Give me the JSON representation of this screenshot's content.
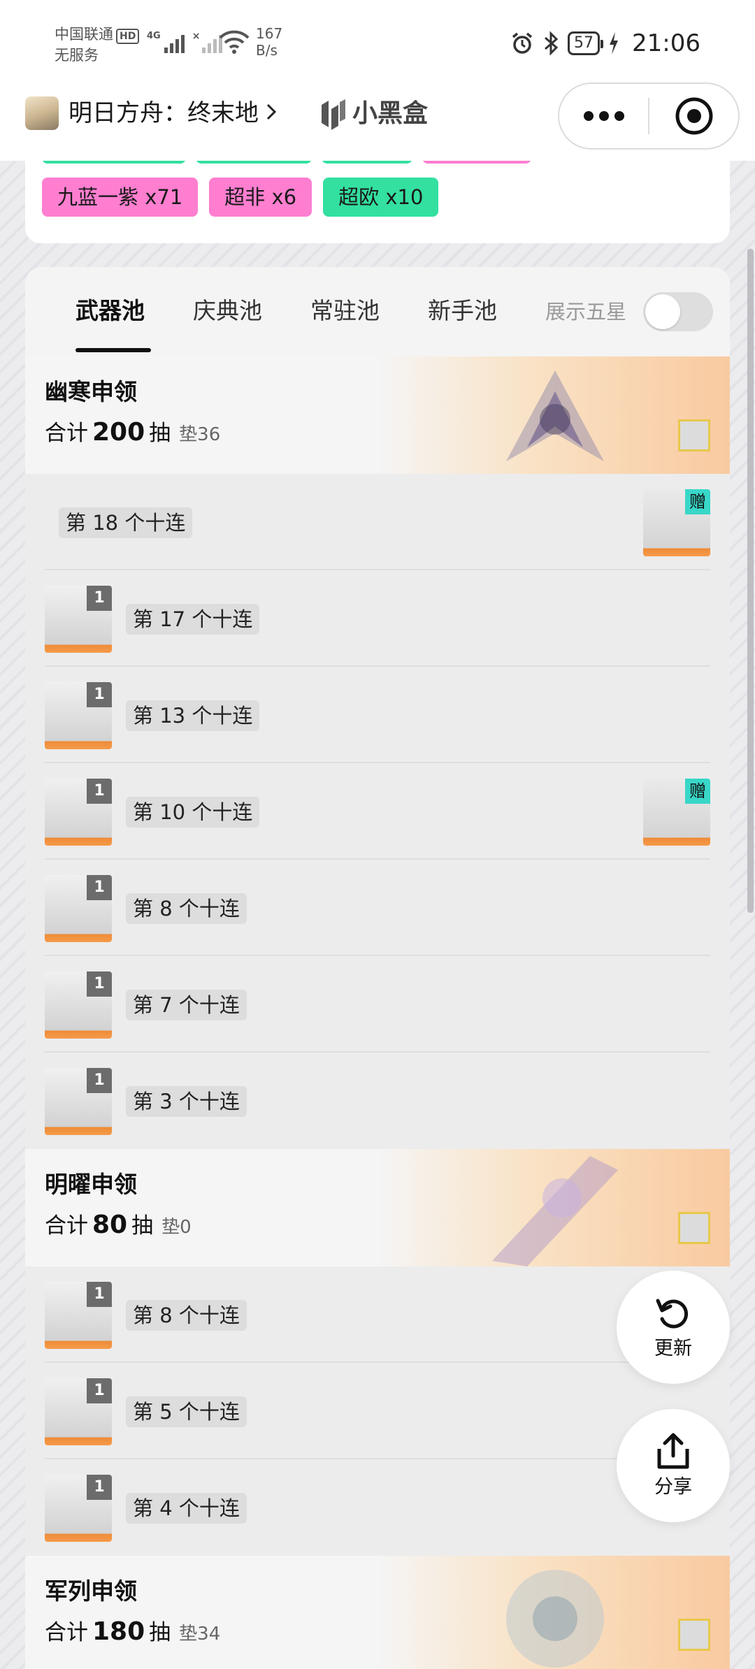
{
  "status_bar": {
    "carrier": "中国联通",
    "hd": "HD",
    "carrier2": "无服务",
    "network": "4G",
    "speed_value": "167",
    "speed_unit": "B/s",
    "battery": "57",
    "time": "21:06"
  },
  "header": {
    "app_title": "明日方舟：终末地",
    "brand_name": "小黑盒"
  },
  "summary_tags": [
    {
      "label": "九蓝一紫 x71",
      "color": "#ff7ed0"
    },
    {
      "label": "超非 x6",
      "color": "#ff7ed0"
    },
    {
      "label": "超欧 x10",
      "color": "#33e0a0"
    }
  ],
  "tabs": [
    {
      "label": "武器池",
      "active": true
    },
    {
      "label": "庆典池",
      "active": false
    },
    {
      "label": "常驻池",
      "active": false
    },
    {
      "label": "新手池",
      "active": false
    }
  ],
  "toggle": {
    "label": "展示五星",
    "on": false
  },
  "pools": [
    {
      "name": "幽寒申领",
      "total_prefix": "合计",
      "total": "200",
      "total_suffix": "抽",
      "pity": "垫36",
      "rows": [
        {
          "label": "第 18 个十连",
          "count": null,
          "gift": "赠"
        },
        {
          "label": "第 17 个十连",
          "count": "1",
          "gift": null
        },
        {
          "label": "第 13 个十连",
          "count": "1",
          "gift": null
        },
        {
          "label": "第 10 个十连",
          "count": "1",
          "gift": "赠"
        },
        {
          "label": "第 8 个十连",
          "count": "1",
          "gift": null
        },
        {
          "label": "第 7 个十连",
          "count": "1",
          "gift": null
        },
        {
          "label": "第 3 个十连",
          "count": "1",
          "gift": null
        }
      ]
    },
    {
      "name": "明曜申领",
      "total_prefix": "合计",
      "total": "80",
      "total_suffix": "抽",
      "pity": "垫0",
      "rows": [
        {
          "label": "第 8 个十连",
          "count": "1",
          "gift": null
        },
        {
          "label": "第 5 个十连",
          "count": "1",
          "gift": null
        },
        {
          "label": "第 4 个十连",
          "count": "1",
          "gift": null
        }
      ]
    },
    {
      "name": "军列申领",
      "total_prefix": "合计",
      "total": "180",
      "total_suffix": "抽",
      "pity": "垫34",
      "rows": []
    }
  ],
  "fab": {
    "refresh_label": "更新",
    "share_label": "分享"
  }
}
